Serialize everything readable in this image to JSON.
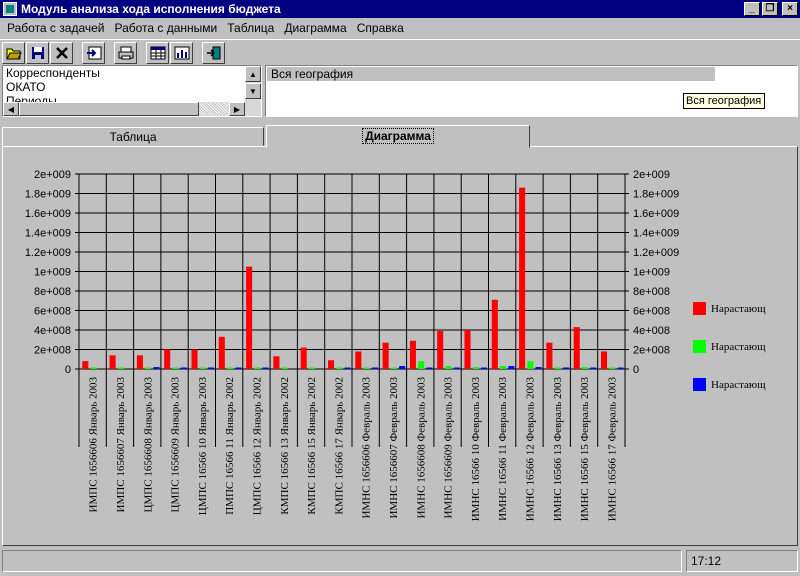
{
  "window": {
    "title": "Модуль анализа хода исполнения бюджета"
  },
  "menu": [
    "Работа с задачей",
    "Работа с данными",
    "Таблица",
    "Диаграмма",
    "Справка"
  ],
  "toolbar": {
    "icons": [
      "open-folder-icon",
      "save-disk-icon",
      "delete-x-icon",
      "import-icon",
      "print-icon",
      "table-view-icon",
      "chart-settings-icon",
      "exit-door-icon"
    ]
  },
  "left_list": {
    "items": [
      "Корреспонденты",
      "ОКАТО",
      "Периоды"
    ]
  },
  "right_panel": {
    "header": "Вся география",
    "tooltip": "Вся география"
  },
  "tabs": [
    {
      "label": "Таблица"
    },
    {
      "label": "Диаграмма"
    }
  ],
  "status": {
    "time": "17:12"
  },
  "chart_data": {
    "type": "bar",
    "ylim": [
      0,
      2000000000
    ],
    "y_ticks": [
      "0",
      "2e+008",
      "4e+008",
      "6e+008",
      "8e+008",
      "1e+009",
      "1.2e+009",
      "1.4e+009",
      "1.6e+009",
      "1.8e+009",
      "2e+009"
    ],
    "grid": true,
    "legend_position": "right",
    "categories": [
      "ИМПС 1656606 Январь 2003",
      "ИМПС 1656607 Январь 2003",
      "ЦМПС 1656608 Январь 2003",
      "ЦМПС 1656609 Январь 2003",
      "ЦМПС 16566 10 Январь 2003",
      "ПМПС 16566 11 Январь 2002",
      "ЦМПС 16566 12 Январь 2002",
      "КМПС 16566 13 Январь 2002",
      "КМПС 16566 15 Январь 2002",
      "КМПС 16566 17 Январь 2002",
      "ИМНС 1656606 Февраль 2003",
      "ИМНС 1656607 Февраль 2003",
      "ИМНС 1656608 Февраль 2003",
      "ИМНС 1656609 Февраль 2003",
      "ИМНС 16566 10 Февраль 2003",
      "ИМНС 16566 11 Февраль 2003",
      "ИМНС 16566 12 Февраль 2003",
      "ИМНС 16566 13 Февраль 2003",
      "ИМНС 16566 15 Февраль 2003",
      "ИМНС 16566 17 Февраль 2003"
    ],
    "series": [
      {
        "name": "Нарастающ",
        "color": "#ff0000",
        "values": [
          80000000,
          140000000,
          140000000,
          200000000,
          200000000,
          330000000,
          1050000000,
          130000000,
          220000000,
          90000000,
          180000000,
          270000000,
          290000000,
          390000000,
          400000000,
          710000000,
          1860000000,
          270000000,
          430000000,
          180000000
        ]
      },
      {
        "name": "Нарастающ",
        "color": "#00ff00",
        "values": [
          5000000,
          5000000,
          5000000,
          5000000,
          5000000,
          5000000,
          8000000,
          5000000,
          5000000,
          5000000,
          8000000,
          15000000,
          80000000,
          30000000,
          20000000,
          30000000,
          80000000,
          15000000,
          20000000,
          15000000
        ]
      },
      {
        "name": "Нарастающ",
        "color": "#0000ff",
        "values": [
          0,
          0,
          20000000,
          10000000,
          5000000,
          10000000,
          15000000,
          0,
          0,
          10000000,
          10000000,
          30000000,
          10000000,
          10000000,
          10000000,
          30000000,
          20000000,
          10000000,
          10000000,
          10000000
        ]
      }
    ]
  }
}
